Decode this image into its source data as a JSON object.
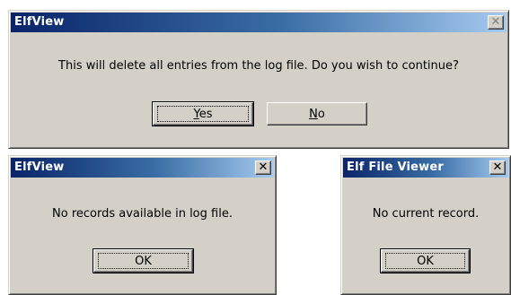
{
  "dialogs": [
    {
      "title": "ElfView",
      "close_glyph": "✕",
      "message": "This will delete all entries from the log file. Do you wish to continue?",
      "buttons": [
        {
          "mnemonic": "Y",
          "rest": "es"
        },
        {
          "mnemonic": "N",
          "rest": "o"
        }
      ]
    },
    {
      "title": "ElfView",
      "close_glyph": "✕",
      "message": "No records available in log file.",
      "buttons": [
        {
          "label": "OK"
        }
      ]
    },
    {
      "title": "Elf File Viewer",
      "close_glyph": "✕",
      "message": "No current record.",
      "buttons": [
        {
          "label": "OK"
        }
      ]
    }
  ],
  "colors": {
    "dialog_face": "#d4d0c8",
    "titlebar_start": "#0a246a",
    "titlebar_end": "#a6caf0",
    "title_text": "#ffffff"
  }
}
